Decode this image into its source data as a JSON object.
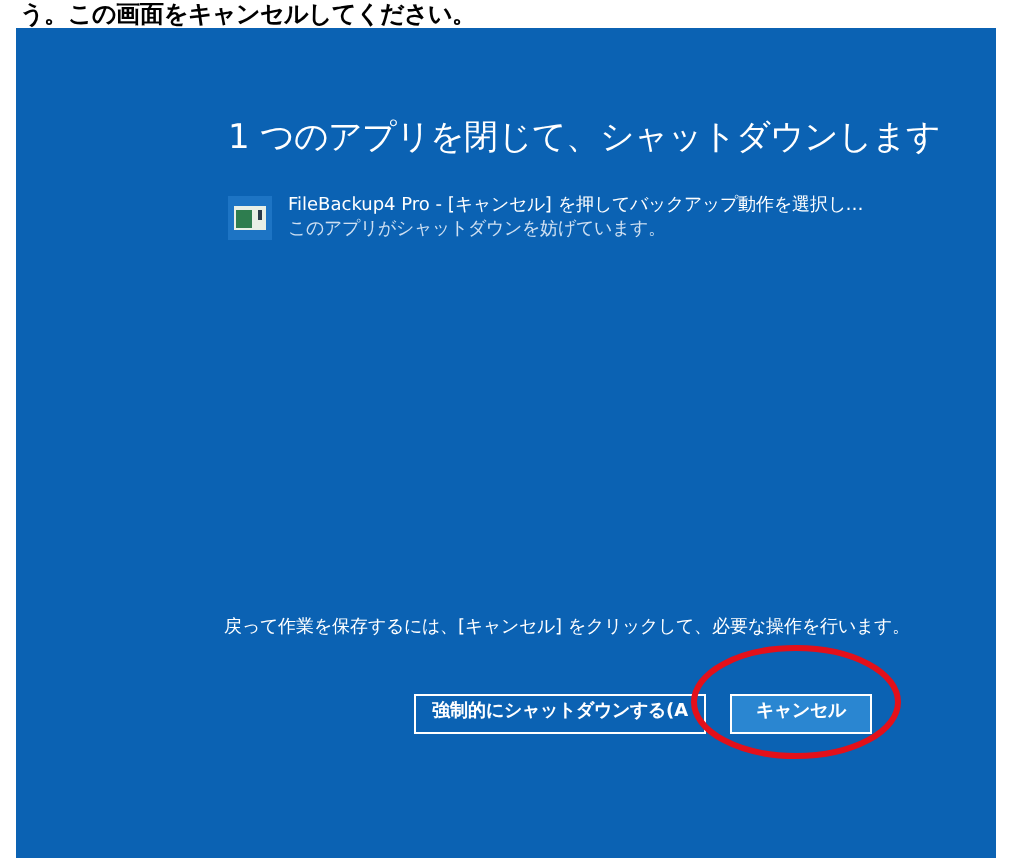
{
  "caption": "う。この画面をキャンセルしてください。",
  "dialog": {
    "title": "1 つのアプリを閉じて、シャットダウンします",
    "apps": [
      {
        "name": "FileBackup4 Pro - [キャンセル] を押してバックアップ動作を選択し…",
        "status": "このアプリがシャットダウンを妨げています。"
      }
    ],
    "instruction": "戻って作業を保存するには、[キャンセル] をクリックして、必要な操作を行います。",
    "buttons": [
      {
        "label": "強制的にシャットダウンする(A",
        "kind": "outline"
      },
      {
        "label": "キャンセル",
        "kind": "default",
        "circled": true
      }
    ]
  }
}
